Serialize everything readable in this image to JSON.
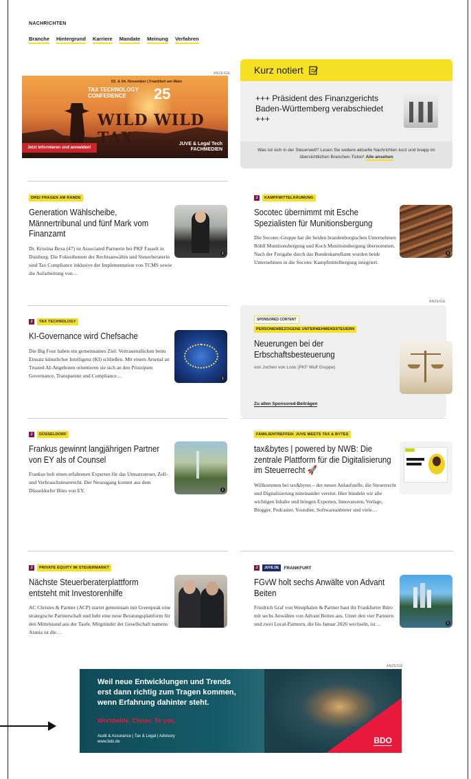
{
  "nav": {
    "title": "NACHRICHTEN",
    "links": [
      "Branche",
      "Hintergrund",
      "Karriere",
      "Mandate",
      "Meinung",
      "Verfahren"
    ]
  },
  "ads": {
    "label": "ANZEIGE",
    "top": {
      "small": "03. & 04. November | Frankfurt am Main",
      "conference_line1": "TAX TECHNOLOGY",
      "conference_line2": "CONFERENCE",
      "number": "25",
      "headline": "WILD WILD TAX",
      "cta": "Jetzt informieren und anmelden!",
      "brand_line1": "JUVE & Legal Tech",
      "brand_line2": "FACHMEDIEN"
    },
    "bottom": {
      "headline_1": "Weil neue Entwicklungen und Trends",
      "headline_2": "erst dann richtig zum Tragen kommen,",
      "headline_3": "wenn Erfahrung dahinter steht.",
      "slogan": "Worldwide. Closer. To you.",
      "small_1": "Audit & Assurance | Tax & Legal | Advisory",
      "small_2": "www.bdo.de",
      "logo": "BDO"
    }
  },
  "kurz": {
    "title": "Kurz notiert",
    "headline": "+++ Präsident des Finanzgerichts Baden-Württemberg verabschiedet +++",
    "footer_text": "Was tut sich in der Steuerwelt? Lesen Sie weitere aktuelle Nachrichten kurz und knapp im übersichtlichen Branchen-Ticker!",
    "footer_link": "Alle ansehen"
  },
  "articles": [
    {
      "tag": "DREI FRAGEN AM RANDE",
      "title": "Generation Wählscheibe, Männertribunal und fünf Mark vom Finanzamt",
      "text": "Dr. Kristina Bexa (47) ist Associated Partnerin bei PKF Fasselt in Duisburg. Die Fokusthemen der Rechtsanwältin und Steuerberaterin sind Tax Compliance inklusive der Implementation von TCMS sowie die Aufarbeitung von…"
    },
    {
      "tag": "KAMPFMITTELRÄUMUNG",
      "title": "Socotec übernimmt mit Esche Spezialisten für Munitionsbergung",
      "text": "Die Socotec-Gruppe hat die beiden brandenburgischen Unternehmen Röhll Munitionsbergung und Koch Munitionsbergung übernommen. Nach der Freigabe durch das Bundeskartellamt wurden beide Unternehmen in die Socotec Kampfmittelbergung integriert."
    },
    {
      "tag": "TAX TECHNOLOGY",
      "title": "KI-Governance wird Chefsache",
      "text": "Die Big Four haben ein gemeinsames Ziel: Vertrauenslücken beim Einsatz künstlicher Intelligenz (KI) schließen. Mit einem Arsenal an Trusted AI-Angeboten orientieren sie sich an den Prinzipien Governance, Transparenz und Compliance…"
    },
    {
      "tag": "DÜSSELDORF",
      "title": "Frankus gewinnt langjährigen Partner von EY als of Counsel",
      "text": "Frankus holt einen erfahrenen Experten für das Umsatzsteuer, Zoll- und Verbrauchsteuerrecht. Der Neuzugang kommt aus dem Düsseldorfer Büro von EY."
    },
    {
      "tag": "FAMILIENTREFFEN: JUVE MEETS TAX & BYTES",
      "title": "tax&bytes | powered by NWB: Die zentrale Plattform für die Digitalisierung im Steuerrecht 🚀",
      "text": "Willkommen bei tax&bytes – der neuen Anlaufstelle, die Steuerrecht und Digitalisierung miteinander vereint. Hier bündeln wir alle wichtigen Inhalte und bringen Experten, Innovatoren, Verlage, Blogger, Podcaster, Youtuber, Softwareanbieter und viele…"
    },
    {
      "tag": "PRIVATE EQUITY IM STEUERMARKT",
      "title": "Nächste Steuerberaterplattform entsteht mit Investorenhilfe",
      "text": "AC Christes & Partner (ACP) startet gemeinsam mit Greenpeak eine strategische Partnerschaft und hebt eine neue Beratungsplattform für den Mittelstand aus der Taufe. Mitgründer der Gesellschaft namens Atania ist die…"
    },
    {
      "tag": "JUVE.DE",
      "city": "FRANKFURT",
      "title": "FGvW holt sechs Anwälte von Advant Beiten",
      "text": "Friedrich Graf von Westphalen & Partner baut ihr Frankfurter Büro mit sechs Anwälten von Advant Beiten aus. Unter den vier Partnern und zwei Local-Partnern, die bis Januar 2026 wechseln, ist…"
    }
  ],
  "sponsored": {
    "badge": "SPONSORED CONTENT",
    "tag": "PERSONENBEZOGENE UNTERNEHMENSSTEUERN",
    "title": "Neuerungen bei der Erbschaftsbesteuerung",
    "by": "von Jochen von Loos (PKF Wulf Gruppe)",
    "link": "Zu allen Sponsored-Beiträgen"
  }
}
